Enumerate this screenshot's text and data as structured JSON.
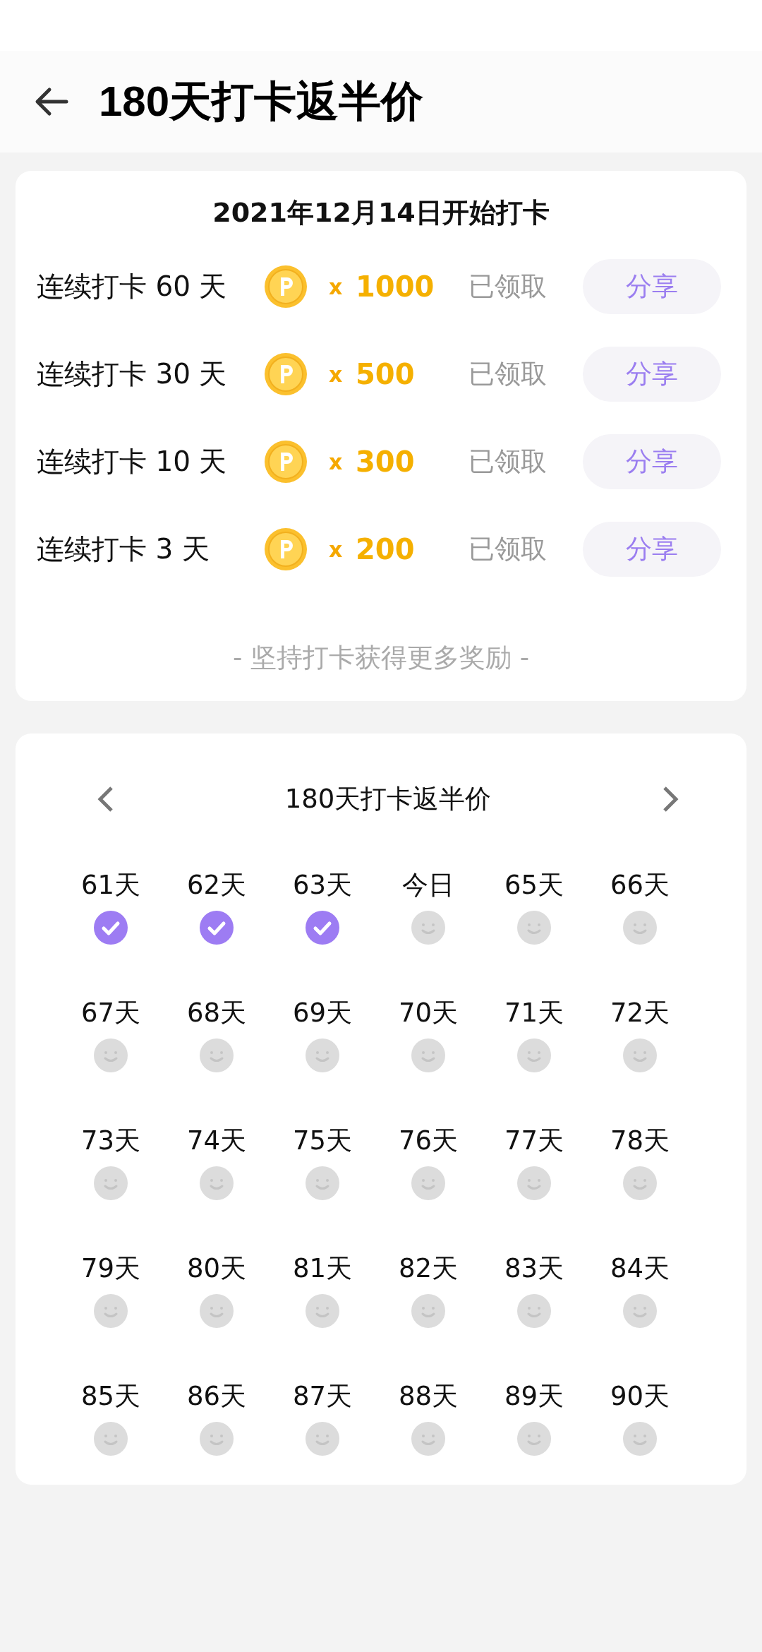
{
  "header": {
    "title": "180天打卡返半价"
  },
  "rewards": {
    "start_date": "2021年12月14日开始打卡",
    "items": [
      {
        "label": "连续打卡 60 天",
        "multiplier": "x",
        "amount": "1000",
        "status": "已领取",
        "button": "分享"
      },
      {
        "label": "连续打卡 30 天",
        "multiplier": "x",
        "amount": "500",
        "status": "已领取",
        "button": "分享"
      },
      {
        "label": "连续打卡 10 天",
        "multiplier": "x",
        "amount": "300",
        "status": "已领取",
        "button": "分享"
      },
      {
        "label": "连续打卡 3 天",
        "multiplier": "x",
        "amount": "200",
        "status": "已领取",
        "button": "分享"
      }
    ],
    "footer": "- 坚持打卡获得更多奖励 -"
  },
  "calendar": {
    "title": "180天打卡返半价",
    "days": [
      {
        "label": "61天",
        "checked": true
      },
      {
        "label": "62天",
        "checked": true
      },
      {
        "label": "63天",
        "checked": true
      },
      {
        "label": "今日",
        "checked": false
      },
      {
        "label": "65天",
        "checked": false
      },
      {
        "label": "66天",
        "checked": false
      },
      {
        "label": "67天",
        "checked": false
      },
      {
        "label": "68天",
        "checked": false
      },
      {
        "label": "69天",
        "checked": false
      },
      {
        "label": "70天",
        "checked": false
      },
      {
        "label": "71天",
        "checked": false
      },
      {
        "label": "72天",
        "checked": false
      },
      {
        "label": "73天",
        "checked": false
      },
      {
        "label": "74天",
        "checked": false
      },
      {
        "label": "75天",
        "checked": false
      },
      {
        "label": "76天",
        "checked": false
      },
      {
        "label": "77天",
        "checked": false
      },
      {
        "label": "78天",
        "checked": false
      },
      {
        "label": "79天",
        "checked": false
      },
      {
        "label": "80天",
        "checked": false
      },
      {
        "label": "81天",
        "checked": false
      },
      {
        "label": "82天",
        "checked": false
      },
      {
        "label": "83天",
        "checked": false
      },
      {
        "label": "84天",
        "checked": false
      },
      {
        "label": "85天",
        "checked": false
      },
      {
        "label": "86天",
        "checked": false
      },
      {
        "label": "87天",
        "checked": false
      },
      {
        "label": "88天",
        "checked": false
      },
      {
        "label": "89天",
        "checked": false
      },
      {
        "label": "90天",
        "checked": false
      }
    ]
  }
}
